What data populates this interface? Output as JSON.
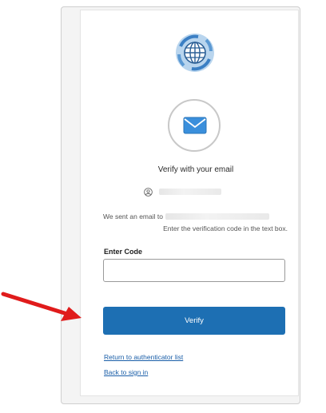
{
  "verify": {
    "title": "Verify with your email",
    "message_prefix": "We sent an email to",
    "message_line2": "Enter the verification code in the text box.",
    "code_label": "Enter Code",
    "code_value": "",
    "verify_label": "Verify"
  },
  "links": {
    "return_label": "Return to authenticator list",
    "back_label": "Back to sign in"
  },
  "colors": {
    "primary": "#1d6fb3",
    "link": "#1a5ea8",
    "annotation_arrow": "#e01b1b"
  },
  "icons": {
    "logo": "globe-icon",
    "mail": "envelope-icon",
    "user": "user-icon"
  }
}
